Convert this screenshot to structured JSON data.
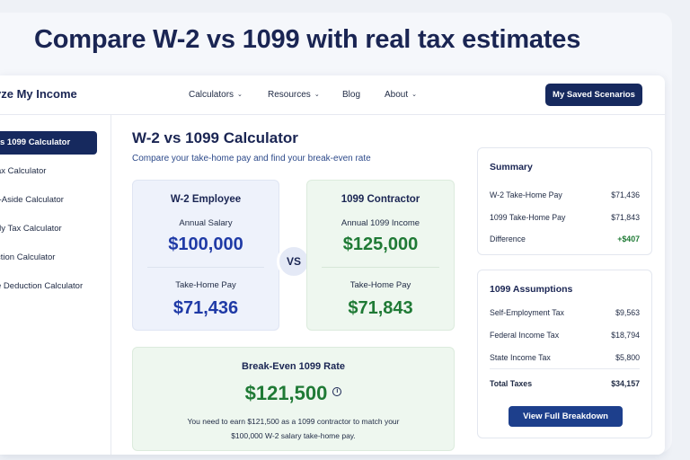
{
  "headline": "Compare W-2 vs 1099 with real tax estimates",
  "brand": "yze My Income",
  "nav": {
    "links": [
      "Calculators",
      "Resources",
      "Blog",
      "About"
    ],
    "saved_button": "My Saved Scenarios"
  },
  "sidebar": {
    "items": [
      {
        "label": "s 1099 Calculator",
        "active": true
      },
      {
        "label": "ax Calculator",
        "active": false
      },
      {
        "label": "t-Aside Calculator",
        "active": false
      },
      {
        "label": "rly Tax Calculator",
        "active": false
      },
      {
        "label": "ction Calculator",
        "active": false
      },
      {
        "label": "e Deduction Calculator",
        "active": false
      }
    ]
  },
  "main": {
    "title": "W-2 vs 1099 Calculator",
    "subtitle": "Compare your take-home pay and find your break-even rate",
    "w2": {
      "title": "W-2 Employee",
      "salary_label": "Annual Salary",
      "salary_value": "$100,000",
      "takehome_label": "Take-Home Pay",
      "takehome_value": "$71,436"
    },
    "vs": "VS",
    "c1099": {
      "title": "1099 Contractor",
      "income_label": "Annual 1099 Income",
      "income_value": "$125,000",
      "takehome_label": "Take-Home Pay",
      "takehome_value": "$71,843"
    },
    "breakeven": {
      "title": "Break-Even 1099 Rate",
      "value": "$121,500",
      "info_glyph": "i",
      "note_line1": "You need to earn $121,500 as a 1099 contractor to match your",
      "note_line2": "$100,000 W-2 salary take-home pay."
    }
  },
  "summary": {
    "title": "Summary",
    "rows": [
      {
        "label": "W-2 Take-Home Pay",
        "value": "$71,436"
      },
      {
        "label": "1099 Take-Home Pay",
        "value": "$71,843"
      },
      {
        "label": "Difference",
        "value": "+$407"
      }
    ]
  },
  "assumptions": {
    "title": "1099 Assumptions",
    "rows": [
      {
        "label": "Self-Employment Tax",
        "value": "$9,563"
      },
      {
        "label": "Federal Income Tax",
        "value": "$18,794"
      },
      {
        "label": "State Income Tax",
        "value": "$5,800"
      }
    ],
    "total": {
      "label": "Total Taxes",
      "value": "$34,157"
    },
    "button": "View Full Breakdown"
  },
  "colors": {
    "navy": "#16295e",
    "blue_value": "#1f3aa6",
    "green_value": "#1f7a35"
  }
}
